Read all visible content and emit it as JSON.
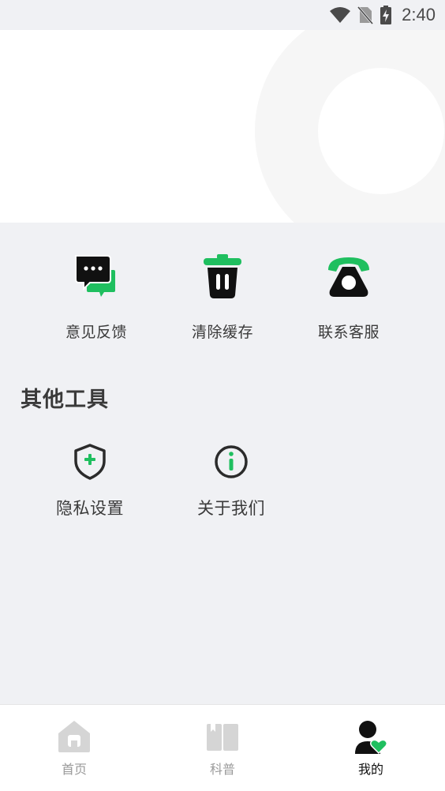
{
  "status_bar": {
    "time": "2:40",
    "icons": [
      "wifi-icon",
      "no-sim-icon",
      "battery-charging-icon"
    ]
  },
  "tools": [
    {
      "label": "意见反馈",
      "icon": "feedback-chat-icon"
    },
    {
      "label": "清除缓存",
      "icon": "trash-icon"
    },
    {
      "label": "联系客服",
      "icon": "telephone-icon"
    }
  ],
  "other_tools": {
    "title": "其他工具",
    "items": [
      {
        "label": "隐私设置",
        "icon": "shield-plus-icon"
      },
      {
        "label": "关于我们",
        "icon": "info-icon"
      }
    ]
  },
  "tab_bar": {
    "items": [
      {
        "label": "首页",
        "icon": "home-icon",
        "active": false
      },
      {
        "label": "科普",
        "icon": "book-icon",
        "active": false
      },
      {
        "label": "我的",
        "icon": "profile-icon",
        "active": true
      }
    ]
  },
  "colors": {
    "accent": "#1fbf5f",
    "icon_dark": "#111111",
    "inactive_tab": "#d5d5d5"
  }
}
